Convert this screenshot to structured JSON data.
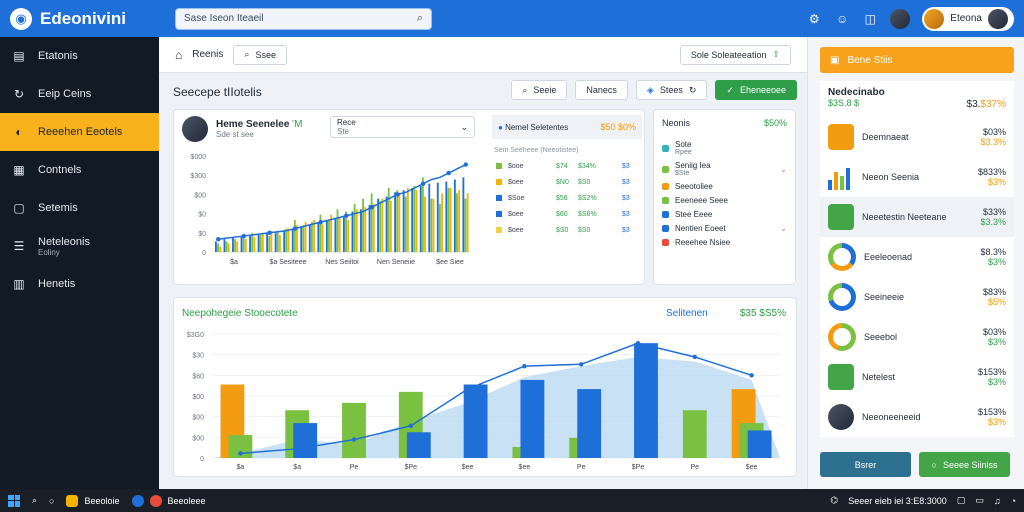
{
  "app": {
    "title": "Edeonivini"
  },
  "search": {
    "value": "Sase Iseon Iteaeil"
  },
  "user": {
    "name": "Eteona"
  },
  "sidebar": {
    "items": [
      {
        "label": "Etatonis",
        "icon": "document-icon"
      },
      {
        "label": "Eeip Ceins",
        "icon": "refresh-icon"
      },
      {
        "label": "Reeehen Eeotels",
        "icon": "chart-icon",
        "active": true
      },
      {
        "label": "Contnels",
        "icon": "grid-icon"
      },
      {
        "label": "Setemis",
        "icon": "square-icon"
      },
      {
        "label": "Neteleonis",
        "sub": "Eoliny",
        "icon": "bars-icon"
      },
      {
        "label": "Henetis",
        "icon": "table-icon"
      }
    ]
  },
  "toolbar": {
    "tab_label": "Reenis",
    "filter_label": "Ssee",
    "right_label": "Sole Soleateeation"
  },
  "section": {
    "title": "Seecepe tIIotelis",
    "btn1": "Seeie",
    "btn2": "Nanecs",
    "btn3": "Stees",
    "btn_primary": "Eheneeoee"
  },
  "card1": {
    "user_name": "Heme Seenelee",
    "user_badge": "'M",
    "user_sub": "Sde st see",
    "select_title": "Rece",
    "select_sub": "Ste",
    "legend_head": "Nemel Seletentes",
    "legend_pct": "$50 $0%",
    "legend_caption": "Sem Seeheee (Neeotistee)",
    "legend_rows": [
      {
        "color": "#7ac142",
        "c1": "$ooe",
        "c2": "$74",
        "c3": "$34%",
        "c4": "$3"
      },
      {
        "color": "#f4b400",
        "c1": "$oee",
        "c2": "$N0",
        "c3": "$S0",
        "c4": "$3"
      },
      {
        "color": "#1e6fd8",
        "c1": "$Soe",
        "c2": "$56",
        "c3": "$S2%",
        "c4": "$3"
      },
      {
        "color": "#1e6fd8",
        "c1": "$oee",
        "c2": "$60",
        "c3": "$S6%",
        "c4": "$3"
      },
      {
        "color": "#f4d03f",
        "c1": "$oee",
        "c2": "$S0",
        "c3": "$S0",
        "c4": "$3"
      }
    ]
  },
  "card2": {
    "title": "Neonis",
    "value": "$50%",
    "items": [
      {
        "color": "#33b5b5",
        "label": "Sote",
        "sub": "Rpee",
        "chev": false
      },
      {
        "color": "#7ac142",
        "label": "Seniig Iea",
        "sub": "$Ste",
        "chev": true
      },
      {
        "color": "#f39c12",
        "label": "Seeotoliee",
        "sub": "",
        "chev": false
      },
      {
        "color": "#7ac142",
        "label": "Eeeneee Seee",
        "sub": "",
        "chev": false
      },
      {
        "color": "#1e6fd8",
        "label": "Stee Eeee",
        "sub": "",
        "chev": false
      },
      {
        "color": "#1e6fd8",
        "label": "Nentien Eoeet",
        "sub": "",
        "chev": true
      },
      {
        "color": "#e74c3c",
        "label": "Reeehee Nsiee",
        "sub": "",
        "chev": false
      }
    ]
  },
  "card3": {
    "title": "Neepohegeie Stooecotete",
    "subtitle": "Selitenen",
    "value": "$35 $S5%"
  },
  "chart_data": [
    {
      "type": "bar",
      "title": "",
      "ylabel": "",
      "y_ticks": [
        "$000",
        "$300",
        "$00",
        "$0",
        "$0",
        "0"
      ],
      "x_ticks": [
        "$a",
        "$a Sesiteee",
        "Nes Seiitoi",
        "Nen Seneiie",
        "$ee Siee"
      ],
      "series": [
        {
          "color": "#1e6fd8",
          "values": [
            10,
            12,
            14,
            15,
            16,
            17,
            18,
            18,
            20,
            22,
            24,
            26,
            28,
            29,
            32,
            34,
            38,
            40,
            44,
            50,
            52,
            56,
            58,
            60,
            62,
            64,
            65,
            66,
            68,
            70
          ]
        },
        {
          "color": "#7ac142",
          "values": [
            8,
            10,
            12,
            14,
            18,
            16,
            15,
            20,
            22,
            30,
            25,
            28,
            35,
            30,
            40,
            38,
            45,
            50,
            55,
            48,
            60,
            58,
            52,
            62,
            70,
            50,
            45,
            60,
            55,
            50
          ]
        },
        {
          "color": "#f4b400",
          "values": [
            5,
            8,
            10,
            12,
            14,
            18,
            20,
            16,
            22,
            25,
            28,
            30,
            26,
            35,
            32,
            30,
            40,
            42,
            45,
            50,
            48,
            55,
            60,
            58,
            52,
            50,
            55,
            60,
            58,
            55
          ]
        }
      ],
      "trend": [
        12,
        13,
        14,
        15,
        16,
        17,
        18,
        19,
        20,
        22,
        24,
        26,
        28,
        30,
        32,
        34,
        36,
        38,
        42,
        46,
        50,
        54,
        56,
        60,
        64,
        68,
        70,
        74,
        78,
        82
      ]
    },
    {
      "type": "bar",
      "title": "Neepohegeie Stooecotete",
      "y_ticks": [
        "$3G0",
        "$30",
        "$60",
        "$00",
        "$00",
        "$00",
        "0"
      ],
      "x_ticks": [
        "$a",
        "$a",
        "Pe",
        "$Pe",
        "$ee",
        "$ee",
        "Pe",
        "$Pe",
        "Pe",
        "$ee"
      ],
      "series": [
        {
          "name": "",
          "color": "#f39c12",
          "values": [
            80,
            0,
            0,
            0,
            0,
            0,
            0,
            0,
            0,
            75
          ]
        },
        {
          "name": "",
          "color": "#7ac142",
          "values": [
            25,
            52,
            60,
            72,
            0,
            12,
            22,
            0,
            52,
            38
          ]
        },
        {
          "name": "",
          "color": "#1e6fd8",
          "values": [
            0,
            38,
            0,
            28,
            80,
            85,
            75,
            125,
            0,
            30
          ]
        }
      ],
      "area": [
        5,
        20,
        15,
        40,
        60,
        88,
        100,
        110,
        105,
        85
      ],
      "line": [
        5,
        10,
        20,
        35,
        75,
        100,
        102,
        125,
        110,
        90
      ]
    }
  ],
  "rpanel": {
    "head_label": "Bene Stiis",
    "summary_title": "Nedecinabo",
    "summary_sub": "$3S.8 $",
    "summary_value": "$3.",
    "summary_value_hl": "$37%",
    "rows": [
      {
        "label": "Deemnaeat",
        "a": "$03%",
        "b": "$3.3%",
        "b_class": "o",
        "icon": "#f39c12",
        "kind": "icon"
      },
      {
        "label": "Neeon Seenia",
        "a": "$833%",
        "b": "$3%",
        "b_class": "o",
        "icon": "#1e6fd8",
        "kind": "bars"
      },
      {
        "label": "Neeetestin Neeteane",
        "a": "$33%",
        "b": "$3.3%",
        "b_class": "b",
        "icon": "#44a548",
        "kind": "icon",
        "hl": true
      },
      {
        "label": "Eeeleoenad",
        "a": "$8.3%",
        "b": "$3%",
        "b_class": "b",
        "ring": "conic-gradient(#1e6fd8 0 35%, #f39c12 0 65%, #7ac142 0)",
        "kind": "ring"
      },
      {
        "label": "Seeineeie",
        "a": "$83%",
        "b": "$5%",
        "b_class": "o",
        "ring": "conic-gradient(#1e6fd8 0 70%, #7ac142 0)",
        "kind": "ring"
      },
      {
        "label": "Seeebol",
        "a": "$03%",
        "b": "$3%",
        "b_class": "b",
        "ring": "conic-gradient(#7ac142 0 55%, #f39c12 0)",
        "kind": "ring"
      },
      {
        "label": "Netelest",
        "a": "$153%",
        "b": "$3%",
        "b_class": "b",
        "icon": "#44a548",
        "kind": "icon"
      },
      {
        "label": "Neeoneeneeid",
        "a": "$153%",
        "b": "$3%",
        "b_class": "o",
        "icon": "#374151",
        "kind": "avatar"
      }
    ],
    "btn_left": "Bsrer",
    "btn_right": "Seeee Siiniss"
  },
  "taskbar": {
    "app1": "Beeoloie",
    "app2": "Beeoleee",
    "status": "Seeer eieb iei 3:E8:3000"
  }
}
